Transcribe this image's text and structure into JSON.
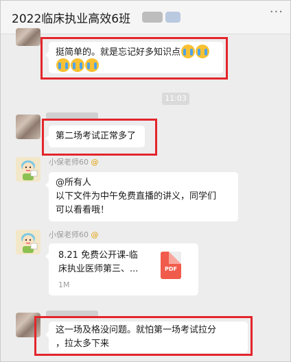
{
  "header": {
    "title": "2022临床执业高效6班",
    "more_icon": "more-dots-icon"
  },
  "chat": {
    "time_separator": "11:03",
    "messages": [
      {
        "sender": "",
        "text": "挺简单的。就是忘记好多知识点",
        "emoji_count": 5,
        "emoji": "loudly-crying-face-icon"
      },
      {
        "sender": "",
        "text": "第二场考试正常多了"
      },
      {
        "sender": "小保老师60",
        "at_mark": "@",
        "lines": [
          "@所有人",
          "以下文件为中午免费直播的讲义，同学们",
          "可以看看哦！"
        ]
      },
      {
        "sender": "小保老师60",
        "at_mark": "@",
        "file": {
          "title_line1": "8.21 免费公开课-临",
          "title_line2": "床执业医师第三、...",
          "size": "1M",
          "type_label": "PDF"
        }
      },
      {
        "sender": "",
        "lines": [
          "这一场及格没问题。就怕第一场考试拉分",
          "，拉太多下来"
        ]
      }
    ]
  },
  "colors": {
    "highlight": "#e3252b",
    "chat_bg": "#ededed",
    "bubble_bg": "#ffffff",
    "pdf": "#f15b4b"
  }
}
